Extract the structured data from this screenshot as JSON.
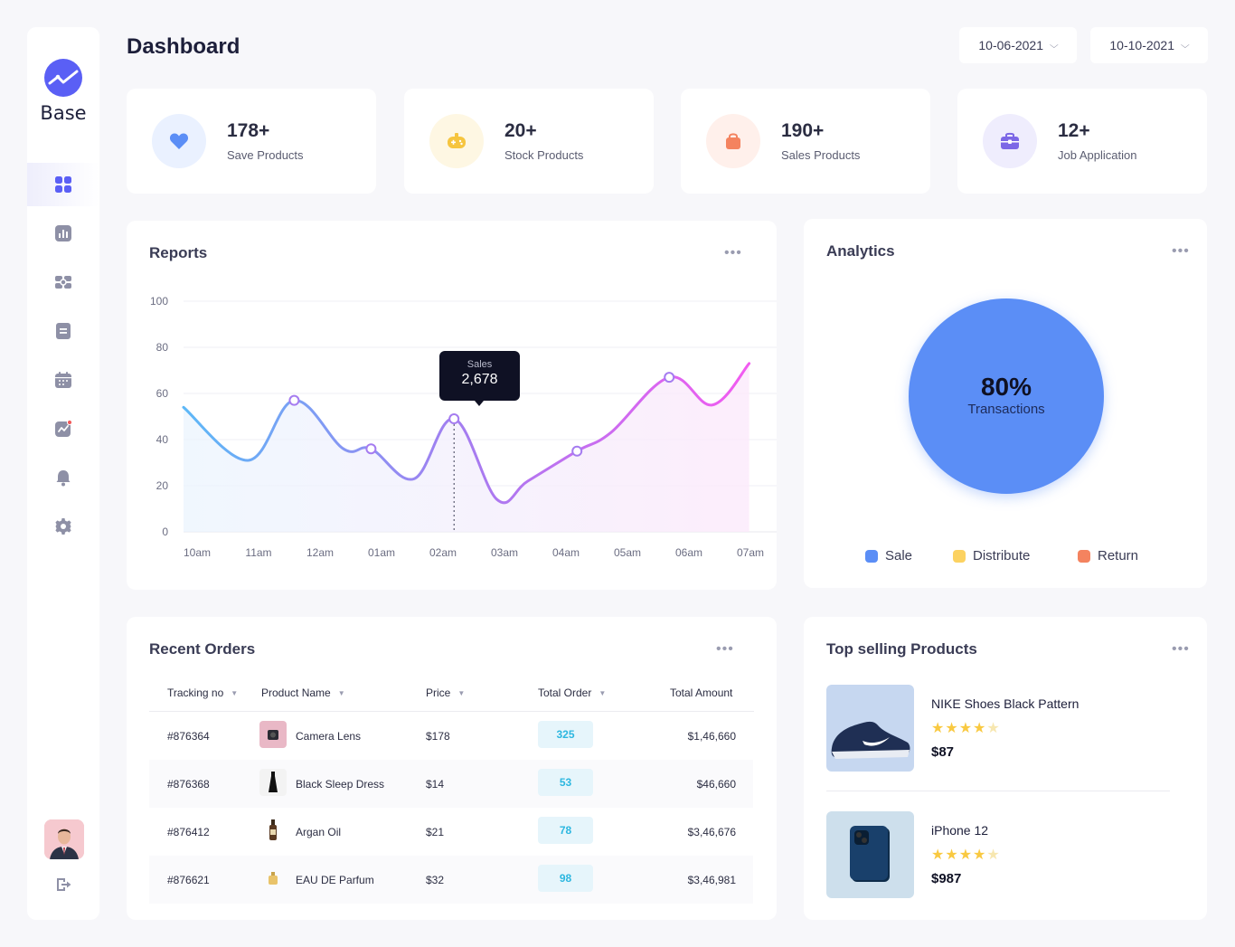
{
  "brand": {
    "name": "Base"
  },
  "sidebar": {
    "items": [
      {
        "icon": "dashboard-icon",
        "active": true
      },
      {
        "icon": "bar-chart-icon"
      },
      {
        "icon": "widgets-icon"
      },
      {
        "icon": "document-icon"
      },
      {
        "icon": "calendar-icon"
      },
      {
        "icon": "trend-icon"
      },
      {
        "icon": "bell-icon"
      },
      {
        "icon": "gear-icon"
      }
    ],
    "logout_icon": "logout-icon"
  },
  "header": {
    "title": "Dashboard",
    "date_from": "10-06-2021",
    "date_to": "10-10-2021"
  },
  "stats": [
    {
      "value": "178+",
      "label": "Save Products",
      "icon": "heart-icon",
      "color": "#5b8ef6",
      "bg": "#eaf1ff"
    },
    {
      "value": "20+",
      "label": "Stock Products",
      "icon": "gamepad-icon",
      "color": "#f6c53f",
      "bg": "#fef7e3"
    },
    {
      "value": "190+",
      "label": "Sales Products",
      "icon": "shopping-bag-icon",
      "color": "#f4835f",
      "bg": "#fff0eb"
    },
    {
      "value": "12+",
      "label": "Job Application",
      "icon": "briefcase-icon",
      "color": "#7c67e6",
      "bg": "#efedfd"
    }
  ],
  "reports": {
    "title": "Reports",
    "tooltip": {
      "label": "Sales",
      "value": "2,678"
    }
  },
  "chart_data": {
    "type": "area",
    "x": [
      "10am",
      "11am",
      "12am",
      "01am",
      "02am",
      "03am",
      "04am",
      "05am",
      "06am",
      "07am"
    ],
    "y_ticks": [
      0,
      20,
      40,
      60,
      80,
      100
    ],
    "ylim": [
      0,
      100
    ],
    "series": [
      {
        "points": [
          [
            0,
            54
          ],
          [
            1.05,
            31
          ],
          [
            1.8,
            57
          ],
          [
            2.6,
            36
          ],
          [
            3.05,
            36
          ],
          [
            3.75,
            23
          ],
          [
            4.4,
            49
          ],
          [
            5.1,
            14
          ],
          [
            5.6,
            22
          ],
          [
            6.4,
            35
          ],
          [
            6.95,
            43
          ],
          [
            7.9,
            67
          ],
          [
            8.6,
            55
          ],
          [
            9.2,
            73
          ]
        ],
        "markers": [
          [
            1.8,
            57
          ],
          [
            3.05,
            36
          ],
          [
            4.4,
            49
          ],
          [
            6.4,
            35
          ],
          [
            7.9,
            67
          ]
        ]
      }
    ],
    "highlight_x": 4.4
  },
  "analytics": {
    "title": "Analytics",
    "center_value": "80%",
    "center_label": "Transactions",
    "legend": [
      {
        "label": "Sale",
        "color": "#5b8ef6"
      },
      {
        "label": "Distribute",
        "color": "#fcd261"
      },
      {
        "label": "Return",
        "color": "#f4835f"
      }
    ]
  },
  "orders": {
    "title": "Recent Orders",
    "columns": [
      "Tracking no",
      "Product Name",
      "Price",
      "Total Order",
      "Total Amount"
    ],
    "rows": [
      {
        "tracking": "#876364",
        "product": "Camera Lens",
        "price": "$178",
        "total_order": "325",
        "amount": "$1,46,660",
        "thumb": "camera-lens-icon"
      },
      {
        "tracking": "#876368",
        "product": "Black Sleep Dress",
        "price": "$14",
        "total_order": "53",
        "amount": "$46,660",
        "thumb": "dress-icon"
      },
      {
        "tracking": "#876412",
        "product": "Argan Oil",
        "price": "$21",
        "total_order": "78",
        "amount": "$3,46,676",
        "thumb": "oil-bottle-icon"
      },
      {
        "tracking": "#876621",
        "product": "EAU DE Parfum",
        "price": "$32",
        "total_order": "98",
        "amount": "$3,46,981",
        "thumb": "perfume-icon"
      }
    ]
  },
  "top_selling": {
    "title": "Top selling Products",
    "products": [
      {
        "name": "NIKE Shoes Black Pattern",
        "rating": 4,
        "price": "$87",
        "image": "sneaker-image"
      },
      {
        "name": "iPhone 12",
        "rating": 4,
        "price": "$987",
        "image": "phone-image"
      }
    ]
  }
}
